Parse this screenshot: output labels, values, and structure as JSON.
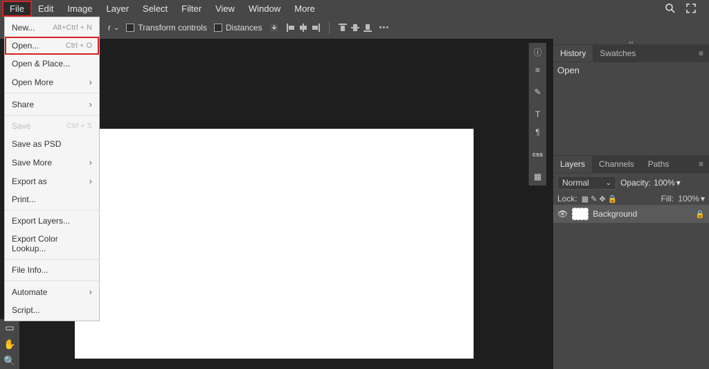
{
  "menubar": {
    "items": [
      "File",
      "Edit",
      "Image",
      "Layer",
      "Select",
      "Filter",
      "View",
      "Window",
      "More"
    ]
  },
  "optionsbar": {
    "dropdown_suffix": "r",
    "transform_label": "Transform controls",
    "distances_label": "Distances"
  },
  "file_menu": {
    "items": [
      {
        "label": "New...",
        "shortcut": "Alt+Ctrl + N",
        "arrow": false,
        "disabled": false,
        "outlined": false,
        "sep": false
      },
      {
        "label": "Open...",
        "shortcut": "Ctrl + O",
        "arrow": false,
        "disabled": false,
        "outlined": true,
        "sep": false
      },
      {
        "label": "Open & Place...",
        "shortcut": "",
        "arrow": false,
        "disabled": false,
        "outlined": false,
        "sep": false
      },
      {
        "label": "Open More",
        "shortcut": "",
        "arrow": true,
        "disabled": false,
        "outlined": false,
        "sep": true
      },
      {
        "label": "Share",
        "shortcut": "",
        "arrow": true,
        "disabled": false,
        "outlined": false,
        "sep": true
      },
      {
        "label": "Save",
        "shortcut": "Ctrl + S",
        "arrow": false,
        "disabled": true,
        "outlined": false,
        "sep": false
      },
      {
        "label": "Save as PSD",
        "shortcut": "",
        "arrow": false,
        "disabled": false,
        "outlined": false,
        "sep": false
      },
      {
        "label": "Save More",
        "shortcut": "",
        "arrow": true,
        "disabled": false,
        "outlined": false,
        "sep": false
      },
      {
        "label": "Export as",
        "shortcut": "",
        "arrow": true,
        "disabled": false,
        "outlined": false,
        "sep": false
      },
      {
        "label": "Print...",
        "shortcut": "",
        "arrow": false,
        "disabled": false,
        "outlined": false,
        "sep": true
      },
      {
        "label": "Export Layers...",
        "shortcut": "",
        "arrow": false,
        "disabled": false,
        "outlined": false,
        "sep": false
      },
      {
        "label": "Export Color Lookup...",
        "shortcut": "",
        "arrow": false,
        "disabled": false,
        "outlined": false,
        "sep": true
      },
      {
        "label": "File Info...",
        "shortcut": "",
        "arrow": false,
        "disabled": false,
        "outlined": false,
        "sep": true
      },
      {
        "label": "Automate",
        "shortcut": "",
        "arrow": true,
        "disabled": false,
        "outlined": false,
        "sep": false
      },
      {
        "label": "Script...",
        "shortcut": "",
        "arrow": false,
        "disabled": false,
        "outlined": false,
        "sep": false
      }
    ]
  },
  "history_panel": {
    "tabs": [
      "History",
      "Swatches"
    ],
    "items": [
      "Open"
    ]
  },
  "layers_panel": {
    "tabs": [
      "Layers",
      "Channels",
      "Paths"
    ],
    "blend_mode": "Normal",
    "opacity_label": "Opacity:",
    "opacity_value": "100%",
    "lock_label": "Lock:",
    "fill_label": "Fill:",
    "fill_value": "100%",
    "layers": [
      {
        "name": "Background",
        "visible": true,
        "locked": true
      }
    ]
  },
  "right_icons": [
    "ⓘ",
    "≡",
    "✎",
    "T",
    "¶",
    "css",
    "▦"
  ]
}
